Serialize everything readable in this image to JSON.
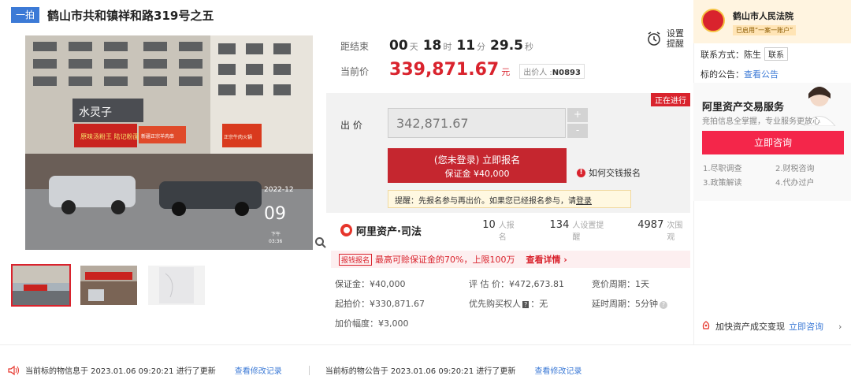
{
  "header": {
    "tag": "一拍",
    "title": "鹤山市共和镇祥和路319号之五"
  },
  "photo": {
    "date_overlay": "2022-12",
    "time_overlay": "09",
    "time_sub": "下午",
    "time_sub2": "03:36",
    "sign_text": "水灵子",
    "shop_sign": "原味汤粉王 陆记粉面",
    "shop_sign2": "新疆正宗羊肉串",
    "shop_sign3": "正宗牛肉火锅"
  },
  "timer": {
    "label": "距结束",
    "days": "00",
    "days_unit": "天",
    "hours": "18",
    "hours_unit": "时",
    "minutes": "11",
    "minutes_unit": "分",
    "seconds": "29.5",
    "seconds_unit": "秒"
  },
  "current_price": {
    "label": "当前价",
    "value": "339,871.67",
    "unit": "元",
    "bidder_label": "出价人",
    "bidder_id": "N0893"
  },
  "remind": {
    "label": "设置提醒"
  },
  "bid": {
    "status": "正在进行",
    "label": "出 价",
    "input_value": "342,871.67",
    "plus": "+",
    "minus": "-",
    "register_line1": "(您未登录) 立即报名",
    "register_line2": "保证金 ¥40,000",
    "howto": "如何交钱报名",
    "tip_text": "提醒：先报名参与再出价。如果您已经报名参与，请",
    "tip_link": "登录"
  },
  "stats": {
    "brand": "阿里资产·司法",
    "registered_num": "10",
    "registered_label": "人报名",
    "reminders_num": "134",
    "reminders_label": "人设置提醒",
    "views_num": "4987",
    "views_label": "次围观"
  },
  "promo": {
    "tag": "报钱报名",
    "text": "最高可赊保证金的70%，上限100万",
    "link": "查看详情 ›"
  },
  "info": {
    "deposit": "保证金：¥40,000",
    "appraisal": "评 估 价：¥472,673.81",
    "cycle": "竞价周期：1天",
    "start_price": "起拍价：¥330,871.67",
    "priority_label": "优先购买权人",
    "priority_value": "：无",
    "delay": "延时周期：5分钟",
    "increment": "加价幅度：¥3,000"
  },
  "court": {
    "name": "鹤山市人民法院",
    "badge": "已启用“一案一账户”",
    "contact_label": "联系方式：陈生",
    "contact_btn": "联系",
    "notice_label": "标的公告：",
    "notice_link": "查看公告"
  },
  "service": {
    "title": "阿里资产交易服务",
    "subtitle": "竞拍信息全掌握，专业服务更放心",
    "consult_btn": "立即咨询",
    "items": [
      "1.尽职调查",
      "2.财税咨询",
      "3.政策解读",
      "4.代办过户"
    ],
    "fast_text": "加快资产成交变现",
    "fast_link": "立即咨询",
    "fast_arrow": "›"
  },
  "footer": {
    "update1": "当前标的物信息于 2023.01.06 09:20:21 进行了更新",
    "link1": "查看修改记录",
    "update2": "当前标的物公告于 2023.01.06 09:20:21 进行了更新",
    "link2": "查看修改记录"
  },
  "colors": {
    "accent_red": "#d9232d",
    "link_blue": "#3c7ad6",
    "consult_pink": "#f4264a"
  }
}
